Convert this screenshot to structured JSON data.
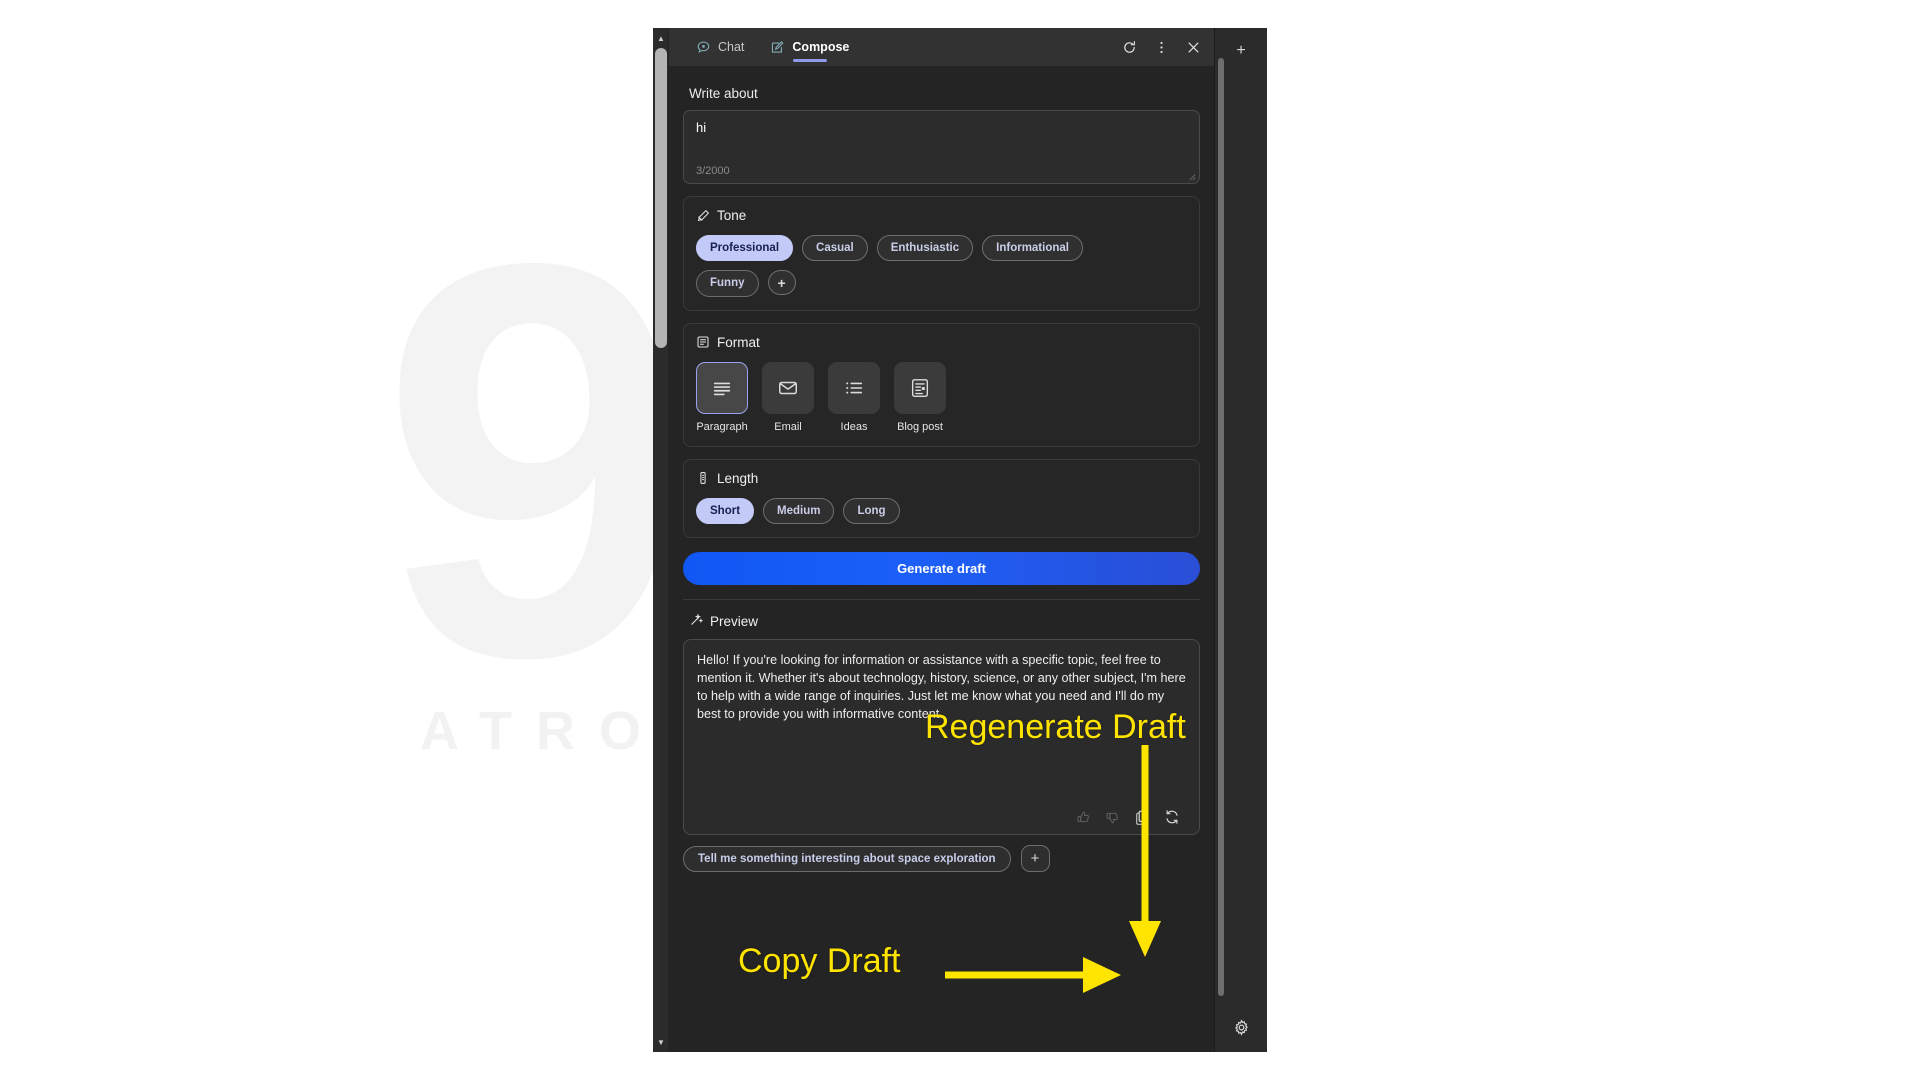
{
  "watermark": {
    "glyph": "9",
    "text": "ATRO ACADEMY"
  },
  "window": {
    "tabs": [
      {
        "label": "Chat",
        "icon": "chat-bubble-icon",
        "active": false
      },
      {
        "label": "Compose",
        "icon": "compose-pencil-icon",
        "active": true
      }
    ],
    "actions": [
      {
        "name": "refresh-icon",
        "label": "Refresh"
      },
      {
        "name": "more-options-icon",
        "label": "More options"
      },
      {
        "name": "close-icon",
        "label": "Close"
      }
    ]
  },
  "write_about": {
    "label": "Write about",
    "value": "hi",
    "placeholder": "Write about",
    "char_count": "3/2000"
  },
  "tone": {
    "label": "Tone",
    "icon": "tone-palette-icon",
    "options": [
      {
        "label": "Professional",
        "selected": true
      },
      {
        "label": "Casual",
        "selected": false
      },
      {
        "label": "Enthusiastic",
        "selected": false
      },
      {
        "label": "Informational",
        "selected": false
      },
      {
        "label": "Funny",
        "selected": false
      }
    ],
    "add_label": "+"
  },
  "format": {
    "label": "Format",
    "icon": "format-document-icon",
    "options": [
      {
        "label": "Paragraph",
        "icon": "paragraph-lines-icon",
        "selected": true
      },
      {
        "label": "Email",
        "icon": "envelope-icon",
        "selected": false
      },
      {
        "label": "Ideas",
        "icon": "bullet-list-icon",
        "selected": false
      },
      {
        "label": "Blog post",
        "icon": "blog-post-icon",
        "selected": false
      }
    ]
  },
  "length": {
    "label": "Length",
    "icon": "length-ruler-icon",
    "options": [
      {
        "label": "Short",
        "selected": true
      },
      {
        "label": "Medium",
        "selected": false
      },
      {
        "label": "Long",
        "selected": false
      }
    ]
  },
  "generate": {
    "label": "Generate draft"
  },
  "preview": {
    "label": "Preview",
    "icon": "magic-wand-icon",
    "text": "Hello! If you're looking for information or assistance with a specific topic, feel free to mention it. Whether it's about technology, history, science, or any other subject, I'm here to help with a wide range of inquiries. Just let me know what you need and I'll do my best to provide you with informative content.",
    "actions": [
      {
        "name": "thumbs-up-icon",
        "label": "Like"
      },
      {
        "name": "thumbs-down-icon",
        "label": "Dislike"
      },
      {
        "name": "copy-draft-icon",
        "label": "Copy draft"
      },
      {
        "name": "regenerate-draft-icon",
        "label": "Regenerate draft"
      }
    ]
  },
  "suggestions": {
    "chip": "Tell me something interesting about space exploration",
    "add_label": "+"
  },
  "rail": {
    "new_label": "+",
    "settings_icon": "gear-icon"
  },
  "annotations": [
    {
      "id": "regenerate",
      "text": "Regenerate Draft",
      "color": "#ffe400"
    },
    {
      "id": "copy",
      "text": "Copy Draft",
      "color": "#ffe400"
    }
  ],
  "colors": {
    "accent_blue": "#1157f5",
    "pill_selected_bg": "#c3caf7",
    "pill_selected_text": "#16214f",
    "tab_underline": "#8f9bea",
    "annotation_yellow": "#ffe400",
    "panel_bg": "#242424",
    "titlebar_bg": "#323232"
  }
}
